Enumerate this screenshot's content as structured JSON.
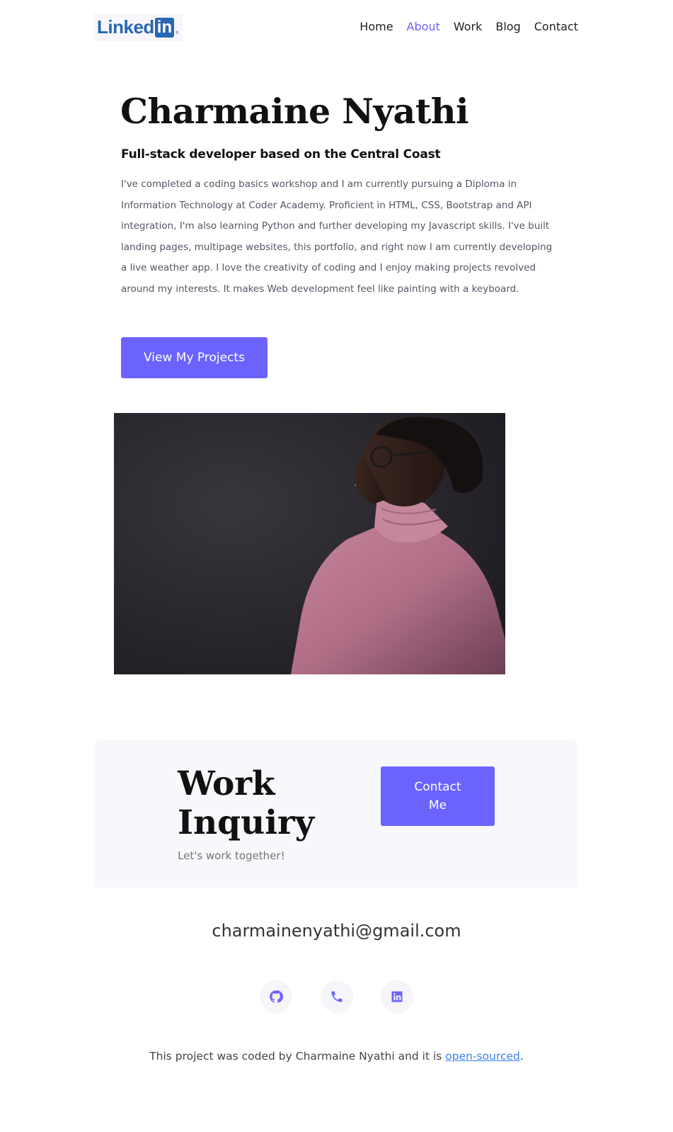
{
  "header": {
    "logo": {
      "text": "Linked",
      "badge": "in",
      "mark": "®",
      "icon": "linkedin-logo"
    },
    "nav": [
      {
        "label": "Home",
        "active": false
      },
      {
        "label": "About",
        "active": true
      },
      {
        "label": "Work",
        "active": false
      },
      {
        "label": "Blog",
        "active": false
      },
      {
        "label": "Contact",
        "active": false
      }
    ]
  },
  "hero": {
    "name": "Charmaine Nyathi",
    "subtitle": "Full-stack developer based on the Central Coast",
    "bio": "I've completed a coding basics workshop and I am currently pursuing a Diploma in Information Technology at Coder Academy. Proficient in HTML, CSS, Bootstrap and API integration, I'm also learning Python and further developing my Javascript skills. I've built landing pages, multipage websites, this portfolio, and right now I am currently developing a live weather app. I love the creativity of coding and I enjoy making projects revolved around my interests. It makes Web development feel like painting with a keyboard.",
    "cta_label": "View My Projects"
  },
  "inquiry": {
    "title": "Work Inquiry",
    "subtitle": "Let's work together!",
    "contact_label": "Contact Me"
  },
  "contact": {
    "email": "charmainenyathi@gmail.com",
    "social": [
      {
        "icon": "github-icon"
      },
      {
        "icon": "phone-icon"
      },
      {
        "icon": "linkedin-icon"
      }
    ]
  },
  "footer": {
    "text_before": "This project was coded by Charmaine Nyathi and it is ",
    "link_label": "open-sourced",
    "text_after": "."
  },
  "colors": {
    "accent": "#6c63ff",
    "linkedin": "#2867b2",
    "link": "#3b82f6",
    "panel": "#f7f7fc"
  }
}
